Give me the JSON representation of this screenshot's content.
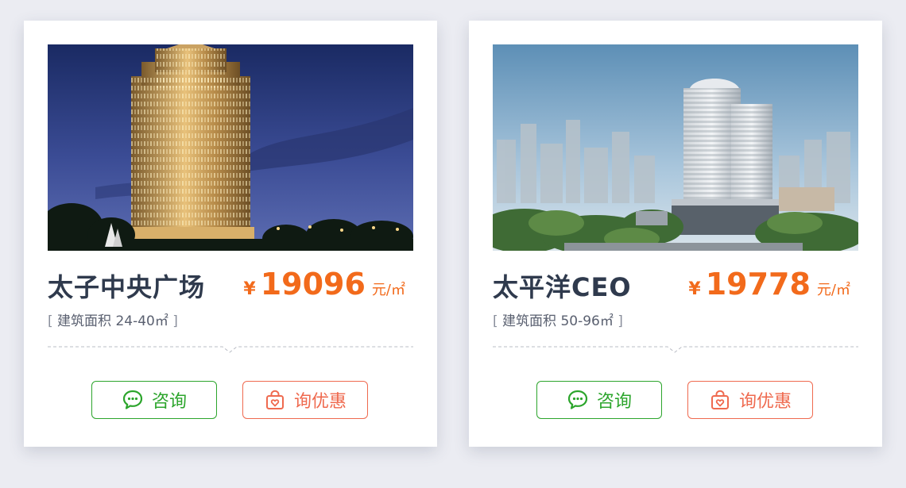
{
  "listings": [
    {
      "name": "太子中央广场",
      "price_symbol": "¥",
      "price": "19096",
      "price_unit": "元/㎡",
      "area_label": "建筑面积 24-40㎡",
      "bracket_open": "[",
      "bracket_close": "]",
      "consult_label": "咨询",
      "deal_label": "询优惠",
      "photo_icon": "night-tower-photo"
    },
    {
      "name": "太平洋CEO",
      "price_symbol": "¥",
      "price": "19778",
      "price_unit": "元/㎡",
      "area_label": "建筑面积 50-96㎡",
      "bracket_open": "[",
      "bracket_close": "]",
      "consult_label": "咨询",
      "deal_label": "询优惠",
      "photo_icon": "day-tower-photo"
    }
  ],
  "colors": {
    "title": "#2f3a4d",
    "price": "#f26a1b",
    "consult": "#2ca52c",
    "deal": "#ef6a4f",
    "background": "#ebecf2"
  },
  "icons": {
    "consult": "chat-bubble-icon",
    "deal": "gift-bag-icon"
  }
}
